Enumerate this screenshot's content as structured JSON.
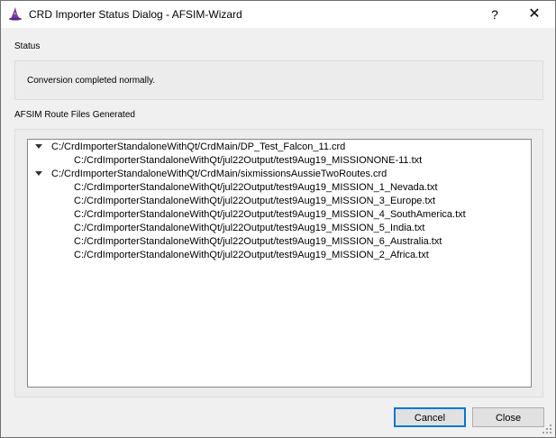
{
  "window": {
    "title": "CRD Importer Status Dialog - AFSIM-Wizard",
    "help_glyph": "?",
    "close_glyph": "✕"
  },
  "status": {
    "label": "Status",
    "message": "Conversion completed normally."
  },
  "route_files": {
    "label": "AFSIM Route Files Generated",
    "items": [
      {
        "path": "C:/CrdImporterStandaloneWithQt/CrdMain/DP_Test_Falcon_11.crd",
        "children": [
          "C:/CrdImporterStandaloneWithQt/jul22Output/test9Aug19_MISSIONONE-11.txt"
        ]
      },
      {
        "path": "C:/CrdImporterStandaloneWithQt/CrdMain/sixmissionsAussieTwoRoutes.crd",
        "children": [
          "C:/CrdImporterStandaloneWithQt/jul22Output/test9Aug19_MISSION_1_Nevada.txt",
          "C:/CrdImporterStandaloneWithQt/jul22Output/test9Aug19_MISSION_3_Europe.txt",
          "C:/CrdImporterStandaloneWithQt/jul22Output/test9Aug19_MISSION_4_SouthAmerica.txt",
          "C:/CrdImporterStandaloneWithQt/jul22Output/test9Aug19_MISSION_5_India.txt",
          "C:/CrdImporterStandaloneWithQt/jul22Output/test9Aug19_MISSION_6_Australia.txt",
          "C:/CrdImporterStandaloneWithQt/jul22Output/test9Aug19_MISSION_2_Africa.txt"
        ]
      }
    ]
  },
  "buttons": {
    "cancel_label": "Cancel",
    "close_label": "Close"
  },
  "icons": {
    "app": "wizard-hat-icon",
    "expand": "expanded-arrow-icon",
    "grip": "size-grip-icon"
  },
  "colors": {
    "default_button_border": "#0078d7",
    "app_icon": "#7b3fb3"
  }
}
